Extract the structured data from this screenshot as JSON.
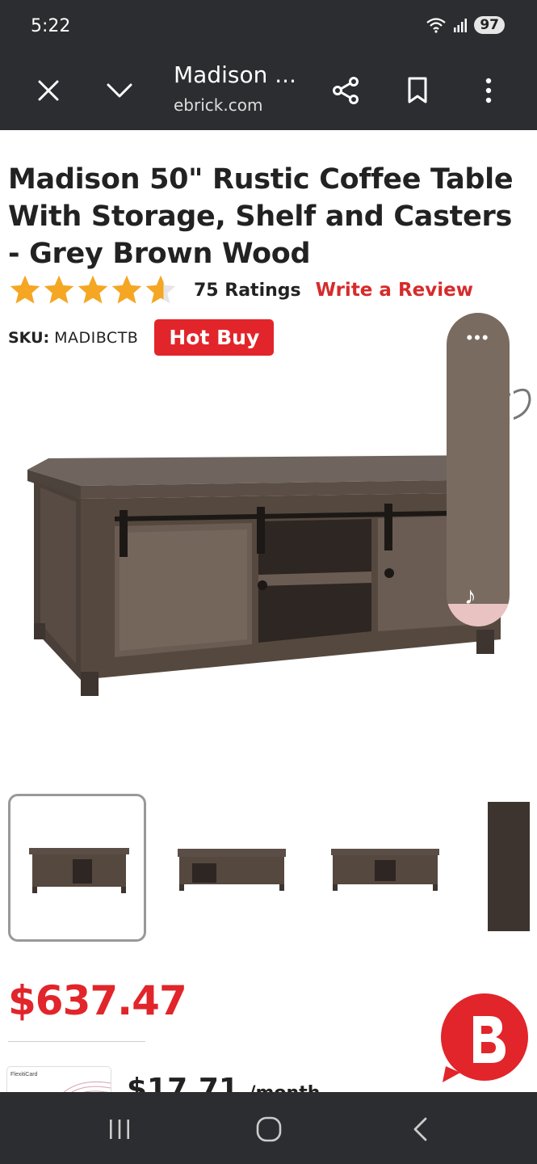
{
  "status_bar": {
    "time": "5:22",
    "battery": "97"
  },
  "toolbar": {
    "title": "Madison ...",
    "url": "ebrick.com"
  },
  "product": {
    "title": "Madison 50\" Rustic Coffee Table With Storage, Shelf and Casters - Grey Brown Wood",
    "rating": 4.5,
    "ratings_count": "75 Ratings",
    "write_review": "Write a Review",
    "sku_label": "SKU:",
    "sku_value": "MADIBCTB",
    "badge": "Hot Buy",
    "price": "$637.47",
    "monthly_price": "$17.71",
    "monthly_unit": "/month",
    "flexiti_label": "FlexitiCard"
  },
  "colors": {
    "accent_red": "#e1252a",
    "star_orange": "#f5a623",
    "chrome_dark": "#2b2d30"
  },
  "icons": {
    "close": "close-icon",
    "chevron": "chevron-down-icon",
    "share": "share-icon",
    "bookmark": "bookmark-icon",
    "menu": "more-vert-icon"
  }
}
